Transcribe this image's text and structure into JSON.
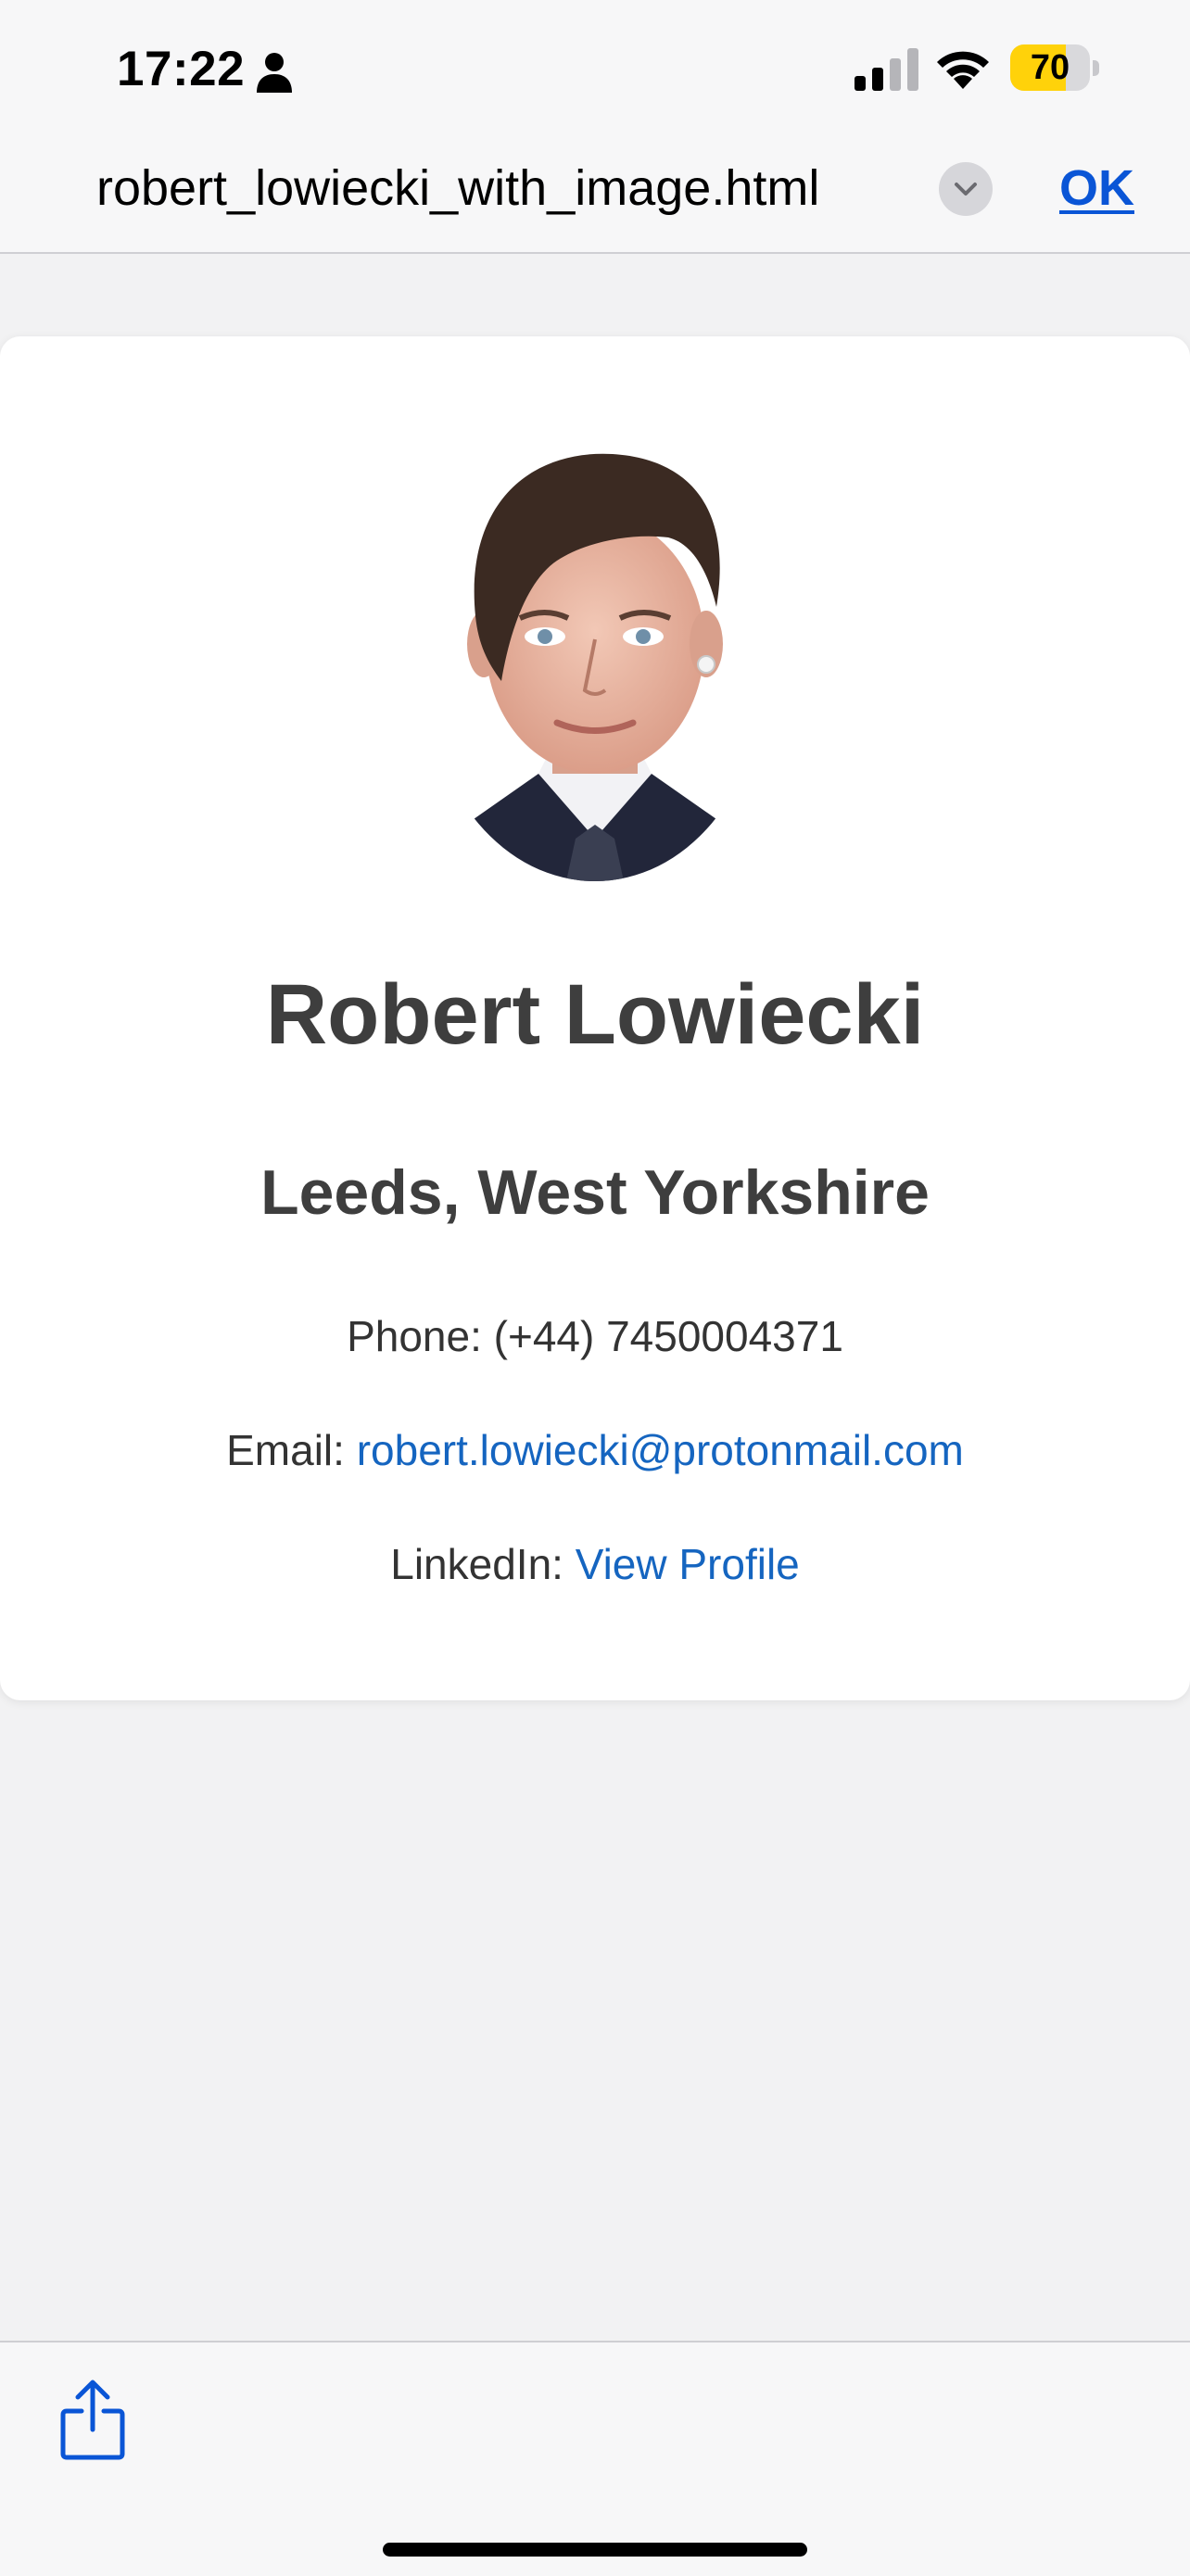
{
  "status_bar": {
    "time": "17:22",
    "battery_level": "70",
    "battery_fraction": 0.7,
    "icons": [
      "person-icon",
      "signal-icon",
      "wifi-icon",
      "battery-icon"
    ]
  },
  "viewer": {
    "file_title": "robert_lowiecki_with_image.html",
    "ok_label": "OK",
    "icons": [
      "chevron-down-icon",
      "share-icon"
    ]
  },
  "profile": {
    "name": "Robert Lowiecki",
    "location": "Leeds, West Yorkshire",
    "phone_label": "Phone:",
    "phone": "(+44) 7450004371",
    "email_label": "Email:",
    "email": "robert.lowiecki@protonmail.com",
    "linkedin_label": "LinkedIn:",
    "linkedin_link": "View Profile"
  },
  "colors": {
    "link": "#1565c0",
    "ok": "#0a55d6",
    "battery": "#ffd20a",
    "heading": "#3e3e3e"
  }
}
